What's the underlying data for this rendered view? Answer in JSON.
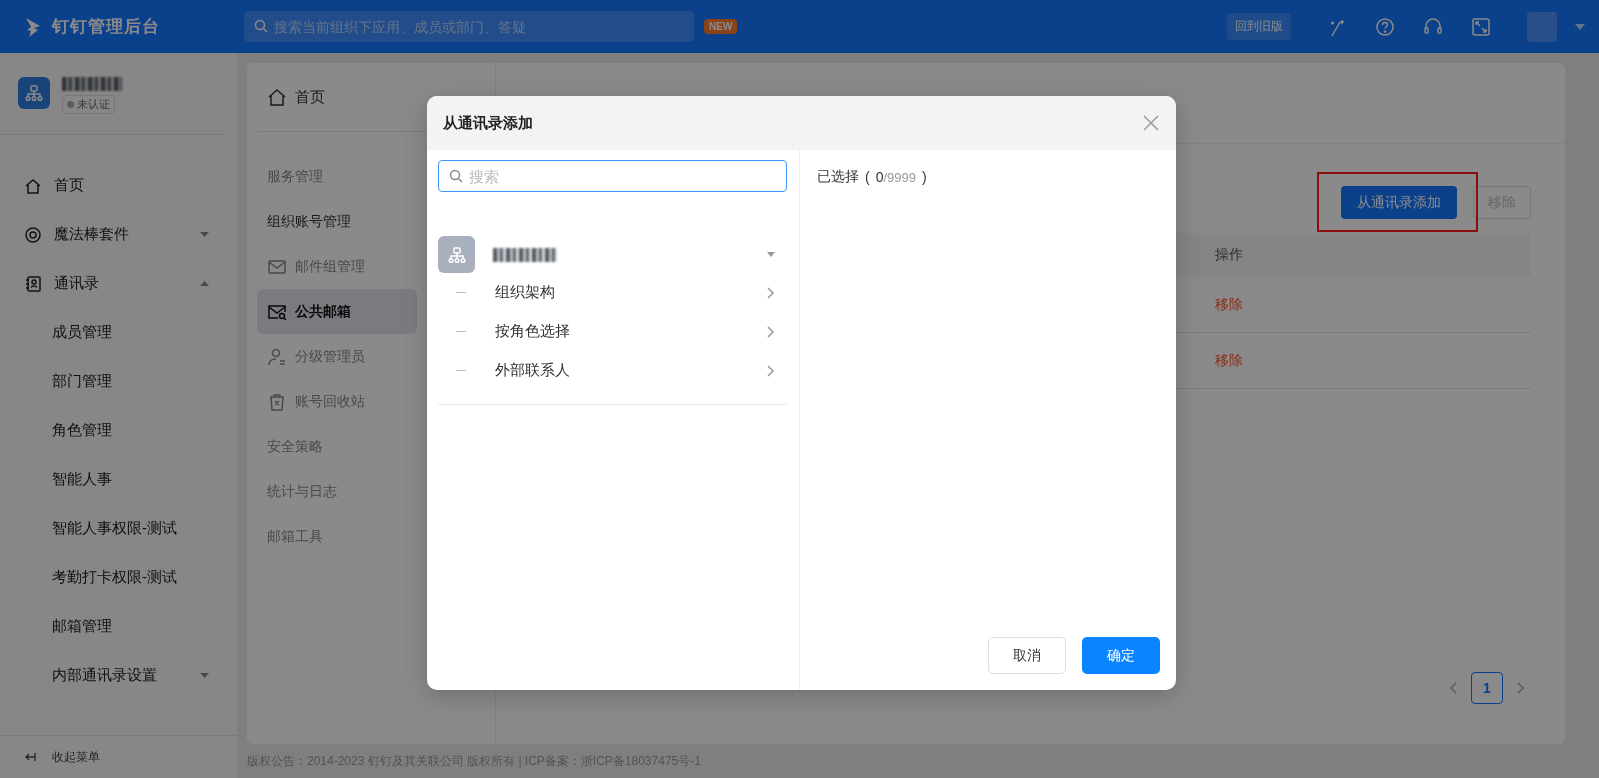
{
  "topbar": {
    "app_title": "钉钉管理后台",
    "search_placeholder": "搜索当前组织下应用、成员或部门、答疑",
    "new_badge": "NEW",
    "old_version_button": "回到旧版"
  },
  "org": {
    "status": "未认证"
  },
  "sidebar": {
    "items": [
      {
        "label": "首页",
        "kind": "top"
      },
      {
        "label": "魔法棒套件",
        "kind": "group",
        "expanded": false
      },
      {
        "label": "通讯录",
        "kind": "group",
        "expanded": true
      },
      {
        "label": "成员管理",
        "kind": "sub"
      },
      {
        "label": "部门管理",
        "kind": "sub"
      },
      {
        "label": "角色管理",
        "kind": "sub"
      },
      {
        "label": "智能人事",
        "kind": "sub"
      },
      {
        "label": "智能人事权限-测试",
        "kind": "sub"
      },
      {
        "label": "考勤打卡权限-测试",
        "kind": "sub"
      },
      {
        "label": "邮箱管理",
        "kind": "sub"
      },
      {
        "label": "内部通讯录设置",
        "kind": "subgroup",
        "expanded": false
      }
    ],
    "collapse": "收起菜单"
  },
  "subnav": {
    "items": [
      {
        "label": "首页",
        "kind": "home"
      },
      {
        "label": "服务管理",
        "kind": "heading",
        "expanded": false
      },
      {
        "label": "组织账号管理",
        "kind": "heading",
        "expanded": true
      },
      {
        "label": "邮件组管理",
        "kind": "item",
        "selected": false
      },
      {
        "label": "公共邮箱",
        "kind": "item",
        "selected": true
      },
      {
        "label": "分级管理员",
        "kind": "item",
        "selected": false
      },
      {
        "label": "账号回收站",
        "kind": "item",
        "selected": false
      },
      {
        "label": "安全策略",
        "kind": "heading",
        "expanded": false
      },
      {
        "label": "统计与日志",
        "kind": "heading",
        "expanded": false
      },
      {
        "label": "邮箱工具",
        "kind": "heading",
        "expanded": false
      }
    ]
  },
  "main": {
    "add_button": "从通讯录添加",
    "remove_button": {
      "label": "移除",
      "disabled": true
    },
    "table": {
      "columns": [
        "操作"
      ],
      "rows": [
        {
          "action": "移除"
        },
        {
          "action": "移除"
        }
      ]
    },
    "pagination": {
      "pages": [
        {
          "label": "1",
          "selected": true
        }
      ]
    }
  },
  "footer": "版权公告：2014-2023 钉钉及其关联公司 版权所有 | ICP备案：浙ICP备18037475号-1",
  "modal": {
    "title": "从通讯录添加",
    "search_placeholder": "搜索",
    "options": [
      "组织架构",
      "按角色选择",
      "外部联系人"
    ],
    "selected_label": "已选择",
    "selected_open": "(",
    "selected_count": "0",
    "selected_max": "/9999",
    "selected_close": ")",
    "cancel_button": "取消",
    "ok_button": "确定"
  }
}
